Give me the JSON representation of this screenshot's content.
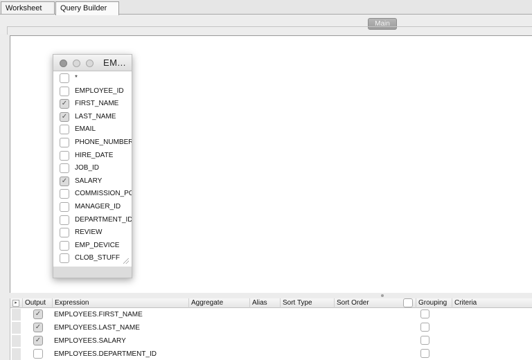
{
  "tabs": [
    {
      "label": "Worksheet",
      "active": false
    },
    {
      "label": "Query Builder",
      "active": true
    }
  ],
  "toolbar": {
    "main_label": "Main"
  },
  "table_box": {
    "title": "EM...",
    "columns": [
      {
        "name": "*",
        "checked": false
      },
      {
        "name": "EMPLOYEE_ID",
        "checked": false
      },
      {
        "name": "FIRST_NAME",
        "checked": true
      },
      {
        "name": "LAST_NAME",
        "checked": true
      },
      {
        "name": "EMAIL",
        "checked": false
      },
      {
        "name": "PHONE_NUMBER",
        "checked": false
      },
      {
        "name": "HIRE_DATE",
        "checked": false
      },
      {
        "name": "JOB_ID",
        "checked": false
      },
      {
        "name": "SALARY",
        "checked": true
      },
      {
        "name": "COMMISSION_PCT",
        "checked": false
      },
      {
        "name": "MANAGER_ID",
        "checked": false
      },
      {
        "name": "DEPARTMENT_ID",
        "checked": false
      },
      {
        "name": "REVIEW",
        "checked": false
      },
      {
        "name": "EMP_DEVICE",
        "checked": false
      },
      {
        "name": "CLOB_STUFF",
        "checked": false
      }
    ]
  },
  "grid": {
    "corner_glyph": "▸",
    "headers": {
      "output": "Output",
      "expression": "Expression",
      "aggregate": "Aggregate",
      "alias": "Alias",
      "sort_type": "Sort Type",
      "sort_order": "Sort Order",
      "grouping": "Grouping",
      "criteria": "Criteria"
    },
    "rows": [
      {
        "output": true,
        "expression": "EMPLOYEES.FIRST_NAME",
        "grouping": false
      },
      {
        "output": true,
        "expression": "EMPLOYEES.LAST_NAME",
        "grouping": false
      },
      {
        "output": true,
        "expression": "EMPLOYEES.SALARY",
        "grouping": false
      },
      {
        "output": false,
        "expression": "EMPLOYEES.DEPARTMENT_ID",
        "grouping": false
      }
    ]
  },
  "icons": {
    "check": "✓"
  },
  "colors": {
    "canvas_bg": "#ffffff",
    "chrome_bg": "#ececec",
    "main_button": "#a9a9a9"
  }
}
